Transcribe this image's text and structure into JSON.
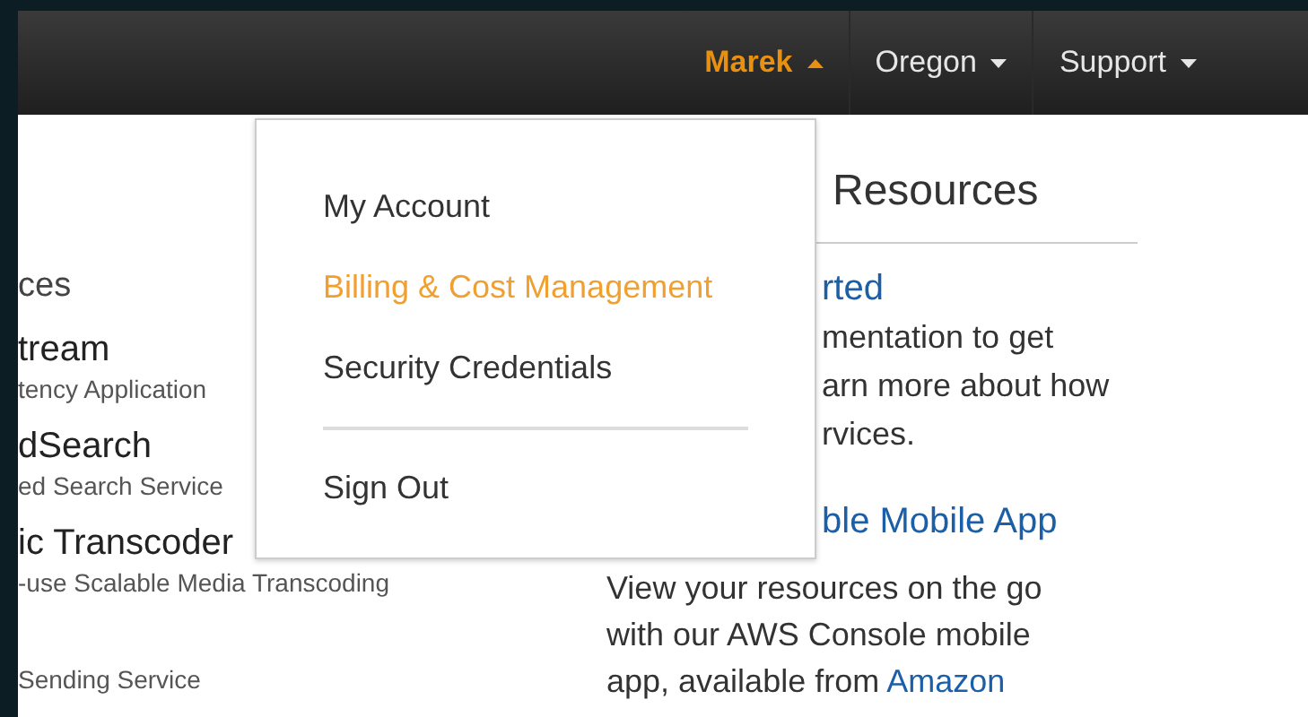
{
  "nav": {
    "items": [
      {
        "label": "Marek",
        "kind": "user",
        "expanded": true
      },
      {
        "label": "Oregon",
        "kind": "menu",
        "expanded": false
      },
      {
        "label": "Support",
        "kind": "menu",
        "expanded": false
      }
    ]
  },
  "user_menu": {
    "items": [
      {
        "label": "My Account",
        "selected": false
      },
      {
        "label": "Billing & Cost Management",
        "selected": true
      },
      {
        "label": "Security Credentials",
        "selected": false
      },
      {
        "label": "Sign Out",
        "selected": false,
        "divider_before": true
      }
    ]
  },
  "services": {
    "heading": "ces",
    "items": [
      {
        "name": "tream",
        "description": "tency Application"
      },
      {
        "name": "dSearch",
        "description": "ed Search Service"
      },
      {
        "name": "ic Transcoder",
        "description": "-use Scalable Media Transcoding"
      },
      {
        "description": "Sending Service"
      }
    ]
  },
  "resources": {
    "heading": "Resources",
    "getting_started": {
      "title": "rted",
      "lines": [
        "mentation to get",
        "arn more about how",
        "rvices."
      ]
    },
    "mobile_app": {
      "title": "ble Mobile App",
      "lines": [
        "View your resources on the go",
        "with our AWS Console mobile"
      ],
      "text": "app, available from ",
      "link": "Amazon"
    }
  }
}
